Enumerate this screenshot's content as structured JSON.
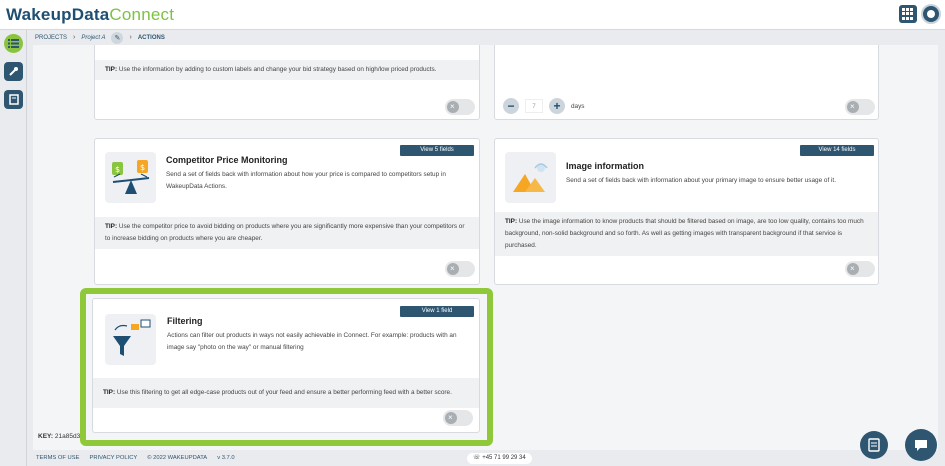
{
  "header": {
    "logo_primary": "WakeupData",
    "logo_secondary": "Connect"
  },
  "breadcrumb": {
    "projects": "PROJECTS",
    "project": "Project A",
    "current": "ACTIONS"
  },
  "cards": {
    "top_left": {
      "tip_label": "TIP:",
      "tip_text": "Use the information by adding to custom labels and change your bid strategy based on high/low priced products."
    },
    "top_right": {
      "days_value": "7",
      "days_label": "days",
      "minus": "−",
      "plus": "+"
    },
    "competitor": {
      "title": "Competitor Price Monitoring",
      "desc": "Send a set of fields back with information about how your price is compared to competitors setup in WakeupData Actions.",
      "view_label": "View 5 fields",
      "tip_label": "TIP:",
      "tip_text": "Use the competitor price to avoid bidding on products where you are significantly more expensive than your competitors or to increase bidding on products where you are cheaper."
    },
    "image_info": {
      "title": "Image information",
      "desc": "Send a set of fields back with information about your primary image to ensure better usage of it.",
      "view_label": "View 14 fields",
      "tip_label": "TIP:",
      "tip_text": "Use the image information to know products that should be filtered based on image, are too low quality, contains too much background, non-solid background and so forth. As well as getting images with transparent background if that service is purchased."
    },
    "filtering": {
      "title": "Filtering",
      "desc": "Actions can filter out products in ways not easily achievable in Connect. For example: products with an image say \"photo on the way\" or manual filtering",
      "view_label": "View 1 field",
      "tip_label": "TIP:",
      "tip_text": "Use this filtering to get all edge-case products out of your feed and ensure a better performing feed with a better score."
    }
  },
  "key": {
    "label": "KEY:",
    "value": "21a85d3"
  },
  "footer": {
    "terms": "TERMS OF USE",
    "privacy": "PRIVACY POLICY",
    "copyright": "© 2022 WAKEUPDATA",
    "version": "v 3.7.0",
    "phone": "+45 71 99 29 34"
  },
  "icons": {
    "menu": "list-icon",
    "actions": "tools-icon",
    "docs": "book-icon",
    "chat": "chat-icon",
    "help": "docs-icon",
    "toggle_off": "x-icon"
  },
  "colors": {
    "brand": "#2e5670",
    "accent": "#8fc93a"
  }
}
